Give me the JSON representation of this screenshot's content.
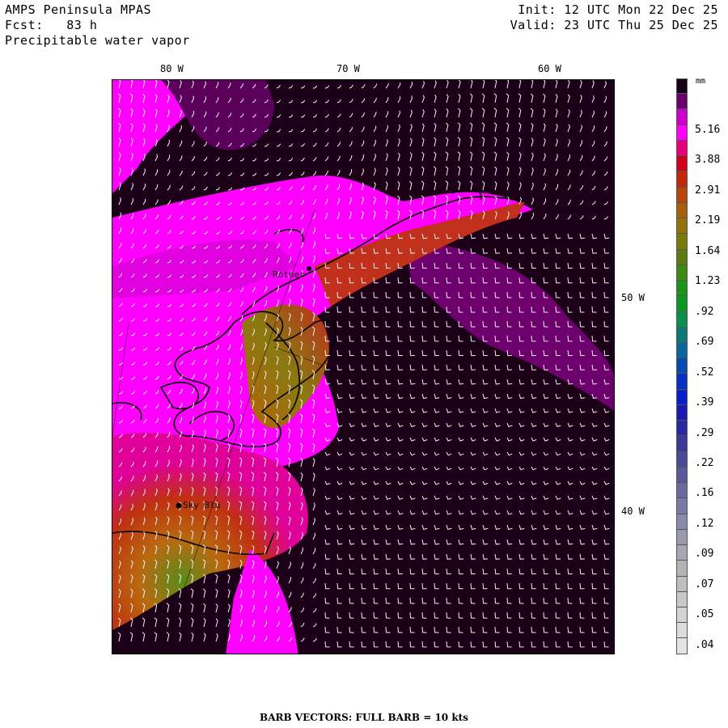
{
  "header": {
    "title": "AMPS Peninsula MPAS",
    "forecast": "Fcst:   83 h",
    "variable": "Precipitable water vapor",
    "init": "Init: 12 UTC Mon 22 Dec 25",
    "valid": "Valid: 23 UTC Thu 25 Dec 25"
  },
  "map": {
    "top_lon_labels": [
      "80 W",
      "70 W",
      "60 W"
    ],
    "right_lon_labels": [
      "50 W",
      "40 W"
    ],
    "places": [
      {
        "name": "Rother"
      },
      {
        "name": "Sky Blu"
      }
    ]
  },
  "legend": {
    "unit": "mm",
    "labels": [
      "5.16",
      "3.88",
      "2.91",
      "2.19",
      "1.64",
      "1.23",
      ".92",
      ".69",
      ".52",
      ".39",
      ".29",
      ".22",
      ".16",
      ".12",
      ".09",
      ".07",
      ".05",
      ".04"
    ],
    "colors": [
      "#1a0016",
      "#6b006b",
      "#cc00cc",
      "#ff00ff",
      "#e6007a",
      "#d0001a",
      "#c2280a",
      "#b8480a",
      "#a86008",
      "#96720a",
      "#7a7a0c",
      "#5f7a10",
      "#3d8a14",
      "#1d9418",
      "#0a9a24",
      "#089050",
      "#087a7a",
      "#08669a",
      "#064ab4",
      "#0630c4",
      "#0a1ec8",
      "#1a1ab0",
      "#2a2aa0",
      "#3a3a9a",
      "#4a4a9a",
      "#5a5a9a",
      "#6a6aa2",
      "#7a7aa6",
      "#8a8aaa",
      "#9a9aae",
      "#a6a6b4",
      "#b4b4b8",
      "#bebebe",
      "#c8c8c8",
      "#d2d2d2",
      "#dcdcdc",
      "#e4e4e4"
    ]
  },
  "footer": "BARB VECTORS:  FULL BARB = 10 kts"
}
